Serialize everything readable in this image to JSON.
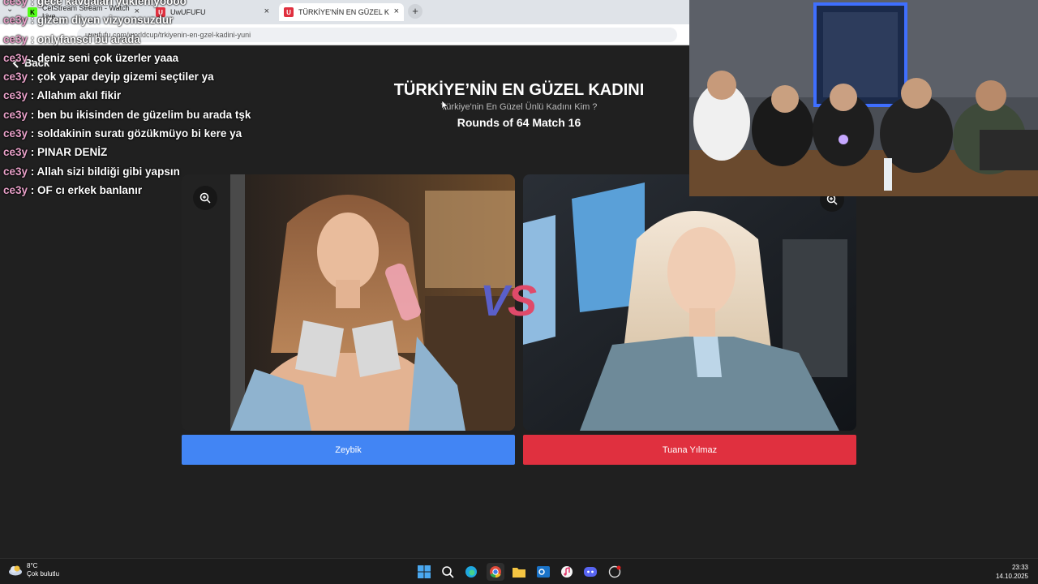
{
  "browser": {
    "tabs": [
      {
        "label": "CetStream Stream - Watch Live",
        "icon": "kick-icon"
      },
      {
        "label": "UwUFUFU",
        "icon": "uwufufu-icon"
      },
      {
        "label": "TÜRKİYE'NİN EN GÜZEL KADINI",
        "icon": "uwufufu-icon"
      }
    ],
    "url": "uwufufu.com/worldcup/trkiyenin-en-gzel-kadini-yuni"
  },
  "page": {
    "back_label": "Back",
    "title": "TÜRKİYE’NİN EN GÜZEL KADINI",
    "subtitle": "Türkiye'nin En Güzel Ünlü Kadını Kim ?",
    "round": "Rounds of 64 Match 16",
    "vs_v": "V",
    "vs_s": "S",
    "left_option": "Zeybik",
    "right_option": "Tuana Yılmaz"
  },
  "chat": [
    {
      "user": "ce3y",
      "msg": "gece kavgaları yükleniyoooo"
    },
    {
      "user": "ce3y",
      "msg": "gizem diyen vizyonsuzdur"
    },
    {
      "user": "ce3y",
      "msg": "onlyfansci bu arada"
    },
    {
      "user": "ce3y",
      "msg": "deniz seni çok üzerler yaaa"
    },
    {
      "user": "ce3y",
      "msg": "çok yapar deyip gizemi seçtiler ya"
    },
    {
      "user": "ce3y",
      "msg": "Allahım akıl fikir"
    },
    {
      "user": "ce3y",
      "msg": "ben bu ikisinden de güzelim bu arada tşk"
    },
    {
      "user": "ce3y",
      "msg": "soldakinin suratı gözükmüyo bi kere ya"
    },
    {
      "user": "ce3y",
      "msg": "PINAR DENİZ"
    },
    {
      "user": "ce3y",
      "msg": "Allah sizi bildiği gibi yapsın"
    },
    {
      "user": "ce3y",
      "msg": "OF cı erkek banlanır"
    }
  ],
  "taskbar": {
    "temp": "8°C",
    "weather_desc": "Çok bulutlu",
    "time": "23:33",
    "date": "14.10.2025"
  },
  "colors": {
    "left_button": "#4285f4",
    "right_button": "#e0303f",
    "chat_user": "#e8a0c8",
    "background": "#202020"
  }
}
